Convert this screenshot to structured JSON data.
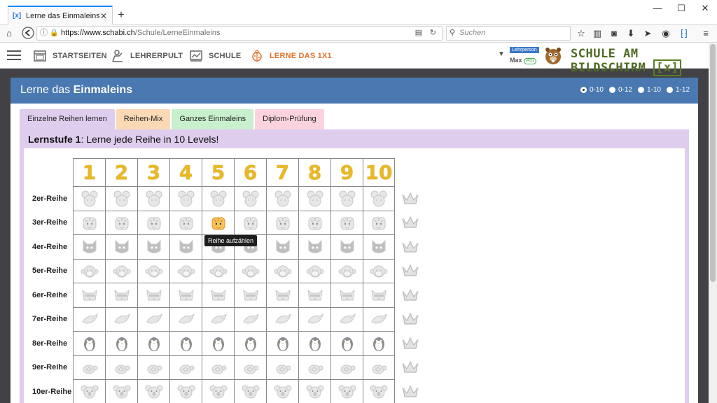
{
  "browser": {
    "tab_title": "Lerne das Einmaleins online",
    "url_host": "https://www.schabi.ch",
    "url_path": "/Schule/LerneEinmaleins",
    "search_placeholder": "Suchen"
  },
  "site": {
    "nav": [
      {
        "label": "STARTSEITEN"
      },
      {
        "label": "LEHRERPULT"
      },
      {
        "label": "SCHULE"
      },
      {
        "label": "LERNE DAS 1X1"
      }
    ],
    "user_role": "Lehrperson",
    "user_name": "Max",
    "user_badge": "Pro",
    "brand_text": "SCHULE AM BILDSCHIRM",
    "brand_mark": "[x]"
  },
  "panel": {
    "title_plain": "Lerne das ",
    "title_bold": "Einmaleins",
    "ranges": [
      "0-10",
      "0-12",
      "1-10",
      "1-12"
    ],
    "selected_range": "0-10",
    "tabs": [
      {
        "label": "Einzelne Reihen lernen",
        "color": "#dfcdee"
      },
      {
        "label": "Reihen-Mix",
        "color": "#fbd9b4"
      },
      {
        "label": "Ganzes Einmaleins",
        "color": "#c9f0cd"
      },
      {
        "label": "Diplom-Prüfung",
        "color": "#fbd3de"
      }
    ],
    "level_bold": "Lernstufe 1",
    "level_text": ": Lerne jede Reihe in 10 Levels!",
    "levels": [
      "1",
      "2",
      "3",
      "4",
      "5",
      "6",
      "7",
      "8",
      "9",
      "10"
    ],
    "rows": [
      {
        "label": "2er-Reihe",
        "animal": "mouse-icon"
      },
      {
        "label": "3er-Reihe",
        "animal": "tiger-icon"
      },
      {
        "label": "4er-Reihe",
        "animal": "cat-icon"
      },
      {
        "label": "5er-Reihe",
        "animal": "monkey-icon"
      },
      {
        "label": "6er-Reihe",
        "animal": "raccoon-icon"
      },
      {
        "label": "7er-Reihe",
        "animal": "dolphin-icon"
      },
      {
        "label": "8er-Reihe",
        "animal": "penguin-icon"
      },
      {
        "label": "9er-Reihe",
        "animal": "turtle-icon"
      },
      {
        "label": "10er-Reihe",
        "animal": "koala-icon"
      }
    ],
    "tooltip": "Reihe aufzählen"
  }
}
